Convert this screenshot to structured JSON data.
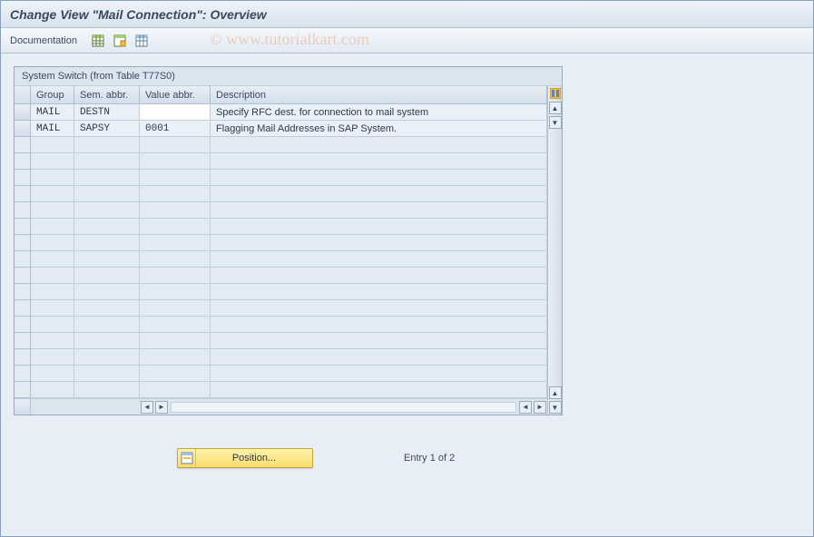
{
  "title": "Change View \"Mail Connection\": Overview",
  "toolbar": {
    "documentation": "Documentation"
  },
  "watermark": "© www.tutorialkart.com",
  "panel": {
    "title": "System Switch (from Table T77S0)"
  },
  "columns": {
    "group": "Group",
    "sem": "Sem. abbr.",
    "value": "Value abbr.",
    "desc": "Description"
  },
  "rows": [
    {
      "group": "MAIL",
      "sem": "DESTN",
      "value": "",
      "desc": "Specify RFC dest. for connection to mail system"
    },
    {
      "group": "MAIL",
      "sem": "SAPSY",
      "value": "0001",
      "desc": "Flagging Mail Addresses in SAP System."
    }
  ],
  "position_button": "Position...",
  "entry_text": "Entry 1 of 2"
}
